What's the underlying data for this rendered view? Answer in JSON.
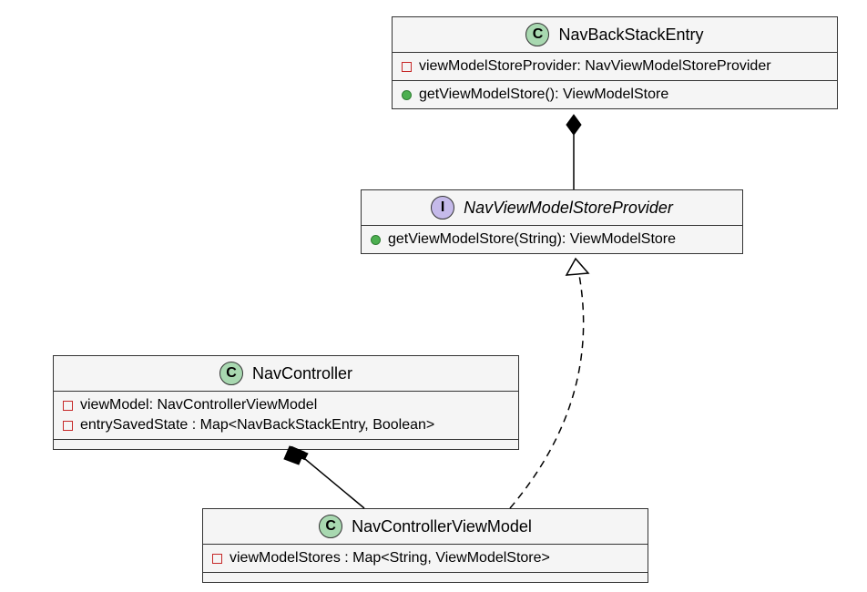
{
  "classes": {
    "navBackStackEntry": {
      "badge": "C",
      "name": "NavBackStackEntry",
      "fields": [
        {
          "vis": "private",
          "text": "viewModelStoreProvider: NavViewModelStoreProvider"
        }
      ],
      "methods": [
        {
          "vis": "public",
          "text": "getViewModelStore(): ViewModelStore"
        }
      ]
    },
    "navViewModelStoreProvider": {
      "badge": "I",
      "name": "NavViewModelStoreProvider",
      "methods": [
        {
          "vis": "public",
          "text": "getViewModelStore(String): ViewModelStore"
        }
      ]
    },
    "navController": {
      "badge": "C",
      "name": "NavController",
      "fields": [
        {
          "vis": "private",
          "text": "viewModel: NavControllerViewModel"
        },
        {
          "vis": "private",
          "text": "entrySavedState : Map<NavBackStackEntry, Boolean>"
        }
      ]
    },
    "navControllerViewModel": {
      "badge": "C",
      "name": "NavControllerViewModel",
      "fields": [
        {
          "vis": "private",
          "text": "viewModelStores : Map<String, ViewModelStore>"
        }
      ]
    }
  },
  "relationships": [
    {
      "from": "NavViewModelStoreProvider",
      "to": "NavBackStackEntry",
      "type": "composition"
    },
    {
      "from": "NavControllerViewModel",
      "to": "NavViewModelStoreProvider",
      "type": "realization"
    },
    {
      "from": "NavControllerViewModel",
      "to": "NavController",
      "type": "composition"
    }
  ]
}
